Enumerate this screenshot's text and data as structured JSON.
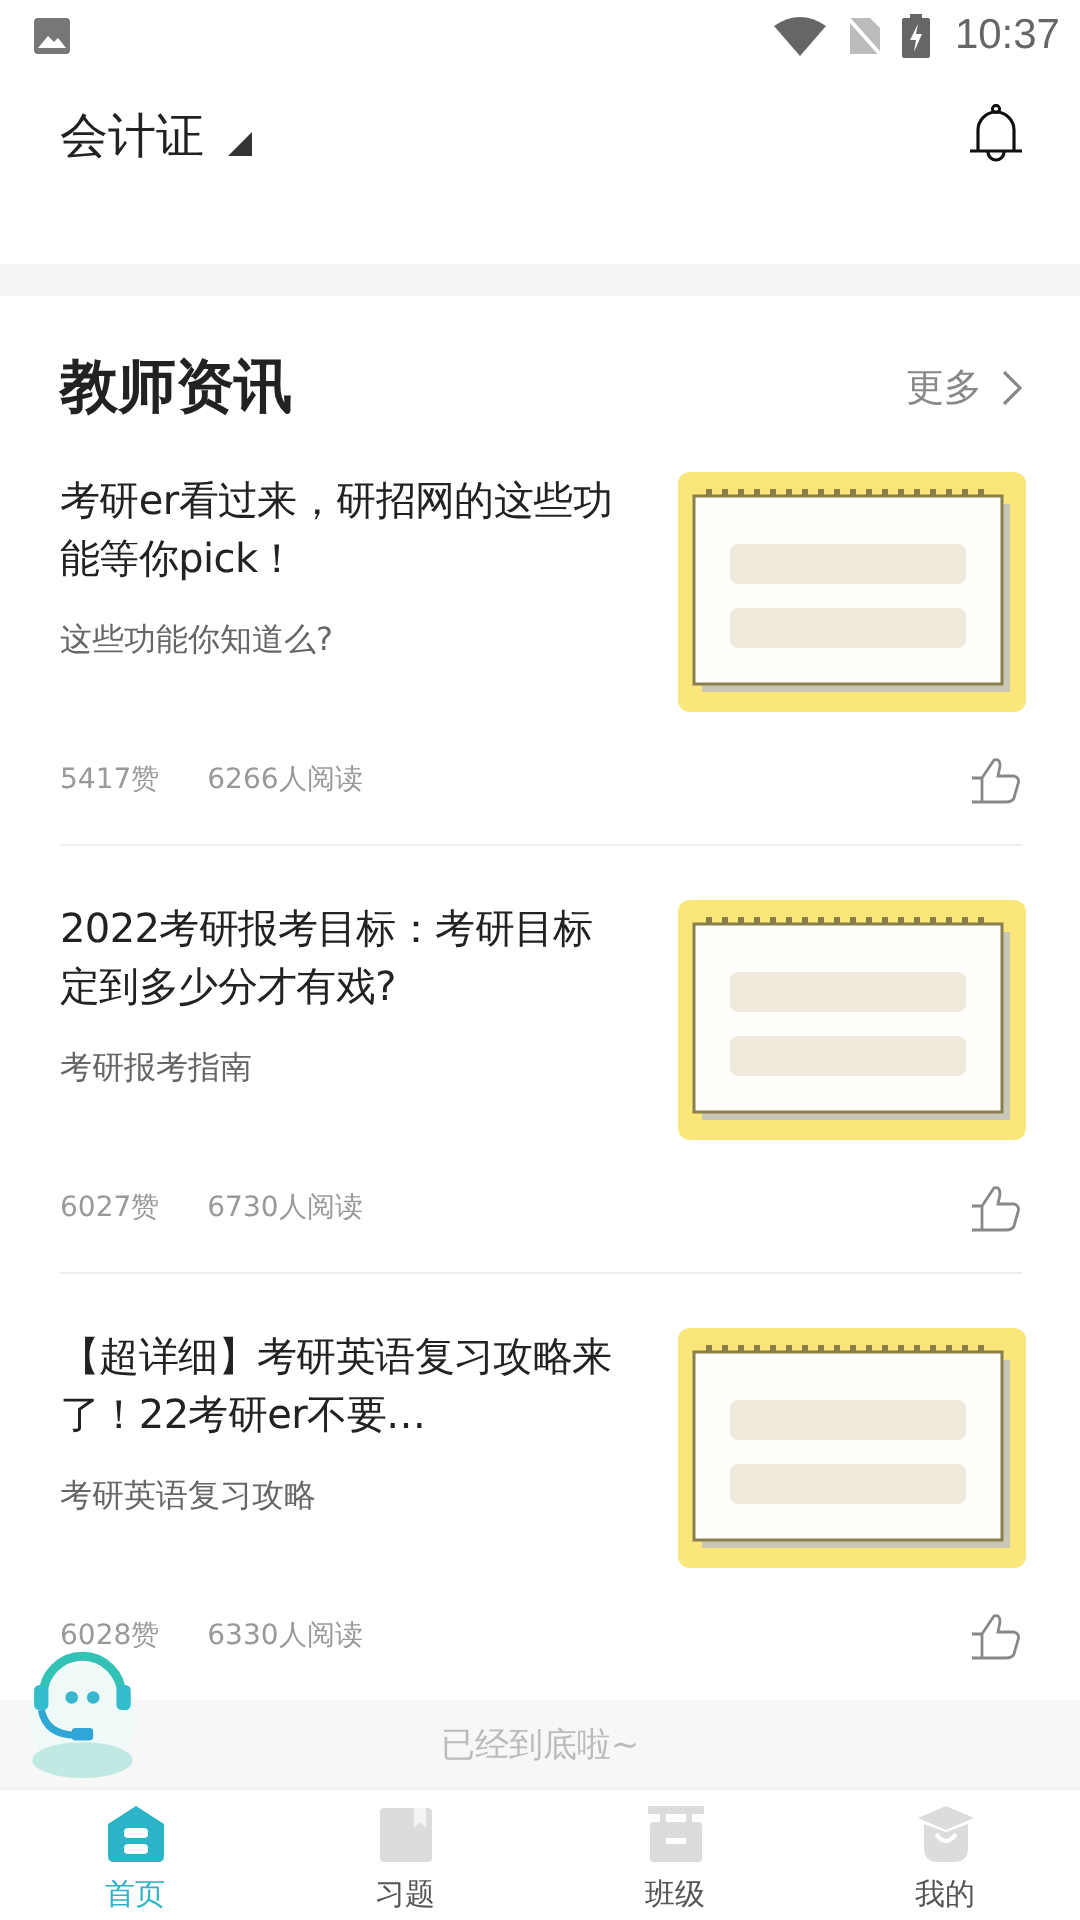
{
  "status_bar": {
    "time": "10:37"
  },
  "header": {
    "title": "会计证"
  },
  "section": {
    "title": "教师资讯",
    "more": "更多"
  },
  "articles": [
    {
      "title": "考研er看过来，研招网的这些功能等你pick！",
      "summary": "这些功能你知道么?",
      "likes": "5417赞",
      "reads": "6266人阅读"
    },
    {
      "title": "2022考研报考目标：考研目标定到多少分才有戏?",
      "summary": "考研报考指南",
      "likes": "6027赞",
      "reads": "6730人阅读"
    },
    {
      "title": "【超详细】考研英语复习攻略来了！22考研er不要…",
      "summary": "考研英语复习攻略",
      "likes": "6028赞",
      "reads": "6330人阅读"
    }
  ],
  "end_note": "已经到底啦~",
  "tab_bar": [
    {
      "label": "首页",
      "kind": "home",
      "selected": true
    },
    {
      "label": "习题",
      "kind": "exercise",
      "selected": false
    },
    {
      "label": "班级",
      "kind": "class",
      "selected": false
    },
    {
      "label": "我的",
      "kind": "profile",
      "selected": false
    }
  ]
}
